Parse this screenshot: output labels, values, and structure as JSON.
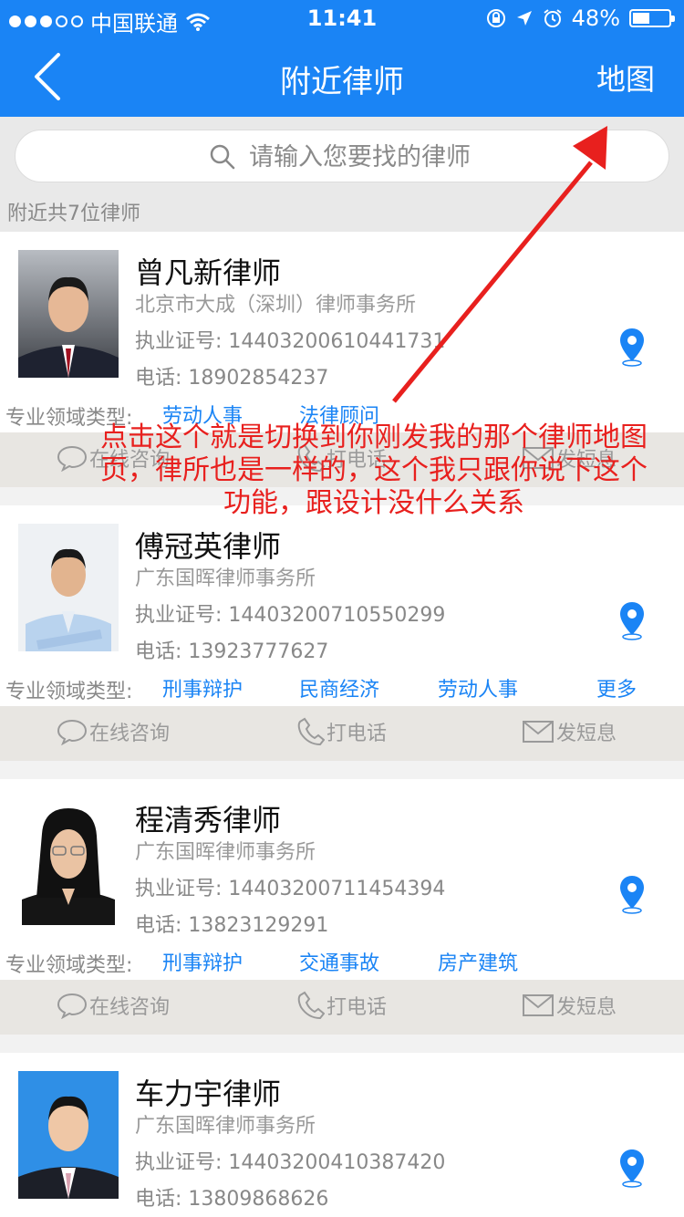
{
  "status_bar": {
    "carrier": "中国联通",
    "time": "11:41",
    "battery": "48%",
    "icons": [
      "signal-dots-icon",
      "wifi-icon",
      "lock-rotation-icon",
      "location-arrow-icon",
      "alarm-icon",
      "battery-icon"
    ]
  },
  "nav": {
    "back_icon": "chevron-left-icon",
    "title": "附近律师",
    "map_label": "地图"
  },
  "search": {
    "placeholder": "请输入您要找的律师",
    "icon": "search-icon"
  },
  "count_text": "附近共7位律师",
  "labels": {
    "specialty": "专业领域类型:",
    "consult": "在线咨询",
    "call": "打电话",
    "sms": "发短息"
  },
  "lawyers": [
    {
      "name": "曾凡新律师",
      "firm": "北京市大成（深圳）律师事务所",
      "license": "执业证号: 14403200610441731",
      "phone": "电话: 18902854237",
      "tags": [
        "劳动人事",
        "法律顾问"
      ]
    },
    {
      "name": "傅冠英律师",
      "firm": "广东国晖律师事务所",
      "license": "执业证号: 14403200710550299",
      "phone": "电话: 13923777627",
      "tags": [
        "刑事辩护",
        "民商经济",
        "劳动人事",
        "更多"
      ]
    },
    {
      "name": "程清秀律师",
      "firm": "广东国晖律师事务所",
      "license": "执业证号: 14403200711454394",
      "phone": "电话: 13823129291",
      "tags": [
        "刑事辩护",
        "交通事故",
        "房产建筑"
      ]
    },
    {
      "name": "车力宇律师",
      "firm": "广东国晖律师事务所",
      "license": "执业证号: 14403200410387420",
      "phone": "电话: 13809868626",
      "tags": []
    }
  ],
  "annotation": "点击这个就是切换到你刚发我的那个律师地图页，律所也是一样的，这个我只跟你说下这个功能，跟设计没什么关系",
  "colors": {
    "brand_blue": "#1a84f5",
    "annotation_red": "#e8201e",
    "action_bar": "#e8e6e2"
  }
}
